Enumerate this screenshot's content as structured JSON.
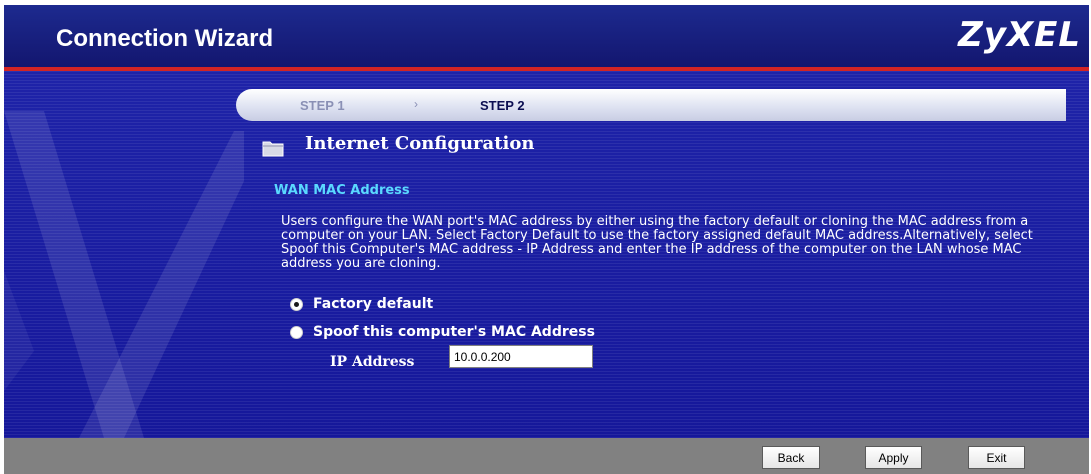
{
  "header": {
    "title": "Connection Wizard",
    "brand": "ZyXEL"
  },
  "steps": {
    "step1": "STEP 1",
    "separator": "›",
    "step2": "STEP 2",
    "current": "STEP 2"
  },
  "section": {
    "title": "Internet Configuration",
    "icon": "folder-icon"
  },
  "wan_mac": {
    "heading": "WAN MAC Address",
    "description": "Users configure the WAN port's MAC address by either using the factory default or cloning the MAC address from a computer on your LAN. Select Factory Default to use the factory assigned default MAC address.Alternatively, select Spoof this Computer's MAC address - IP Address and enter the IP address of the computer on the LAN whose MAC address you are cloning.",
    "option_factory": "Factory default",
    "option_spoof": "Spoof this computer's MAC Address",
    "selected": "Factory default",
    "ip_label": "IP Address",
    "ip_value": "10.0.0.200"
  },
  "footer": {
    "back": "Back",
    "apply": "Apply",
    "exit": "Exit"
  },
  "colors": {
    "accent": "#d32424",
    "background": "#1e23a8",
    "heading": "#5ad9ff"
  }
}
